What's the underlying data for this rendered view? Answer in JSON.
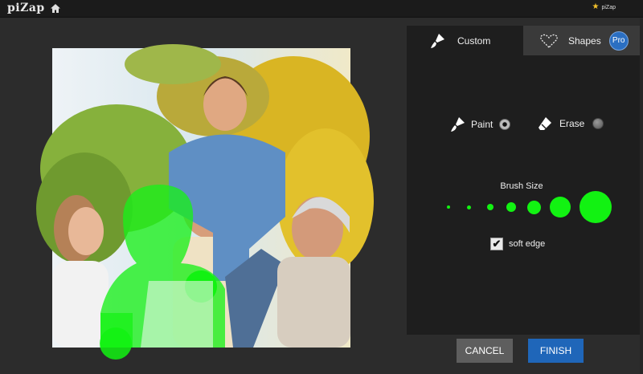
{
  "app": {
    "logo_text": "piZap",
    "user_name": "piZap"
  },
  "tabs": [
    {
      "label": "Custom",
      "icon": "brush-icon",
      "active": true
    },
    {
      "label": "Shapes",
      "icon": "heart-outline-icon",
      "badge": "Pro",
      "active": false
    }
  ],
  "modes": {
    "paint_label": "Paint",
    "paint_selected": true,
    "erase_label": "Erase",
    "erase_selected": false
  },
  "brush": {
    "label": "Brush Size",
    "sizes": [
      1,
      2,
      3,
      4,
      5,
      6,
      7
    ],
    "color": "#12f212"
  },
  "soft_edge": {
    "label": "soft edge",
    "checked": true,
    "check_glyph": "✔"
  },
  "actions": {
    "cancel_label": "CANCEL",
    "finish_label": "FINISH"
  },
  "colors": {
    "accent_blue": "#1f66b9",
    "paint_green": "#12f212",
    "panel_bg": "#1e1e1e"
  }
}
